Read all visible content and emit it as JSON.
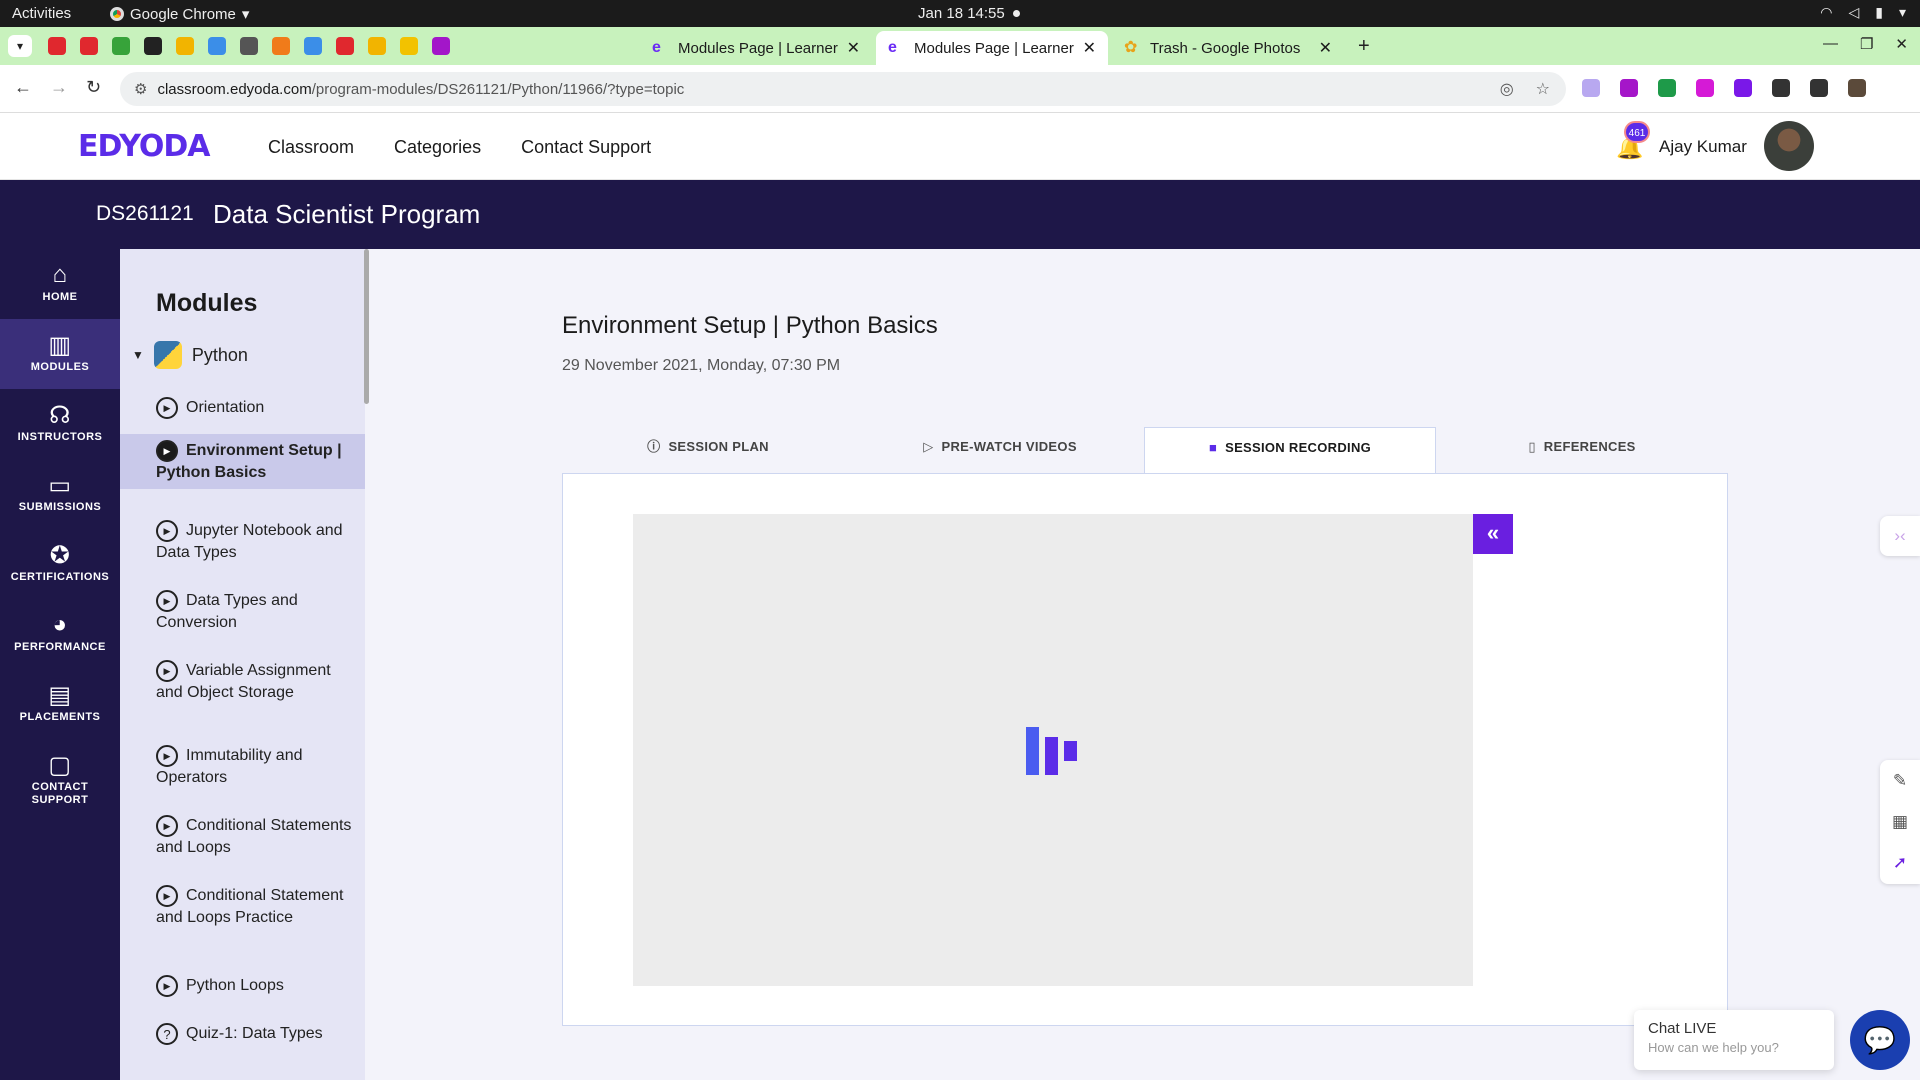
{
  "os": {
    "activities": "Activities",
    "app_name": "Google Chrome",
    "app_caret": "▾",
    "clock": "Jan 18  14:55",
    "tray": [
      "wifi-icon",
      "volume-icon",
      "battery-icon",
      "power-menu-icon"
    ]
  },
  "browser": {
    "tabs": [
      {
        "title": "Modules Page | Learner",
        "active": false
      },
      {
        "title": "Modules Page | Learner",
        "active": true
      },
      {
        "title": "Trash - Google Photos",
        "active": false
      }
    ],
    "tab_close": "✕",
    "new_tab": "+",
    "url_host": "classroom.edyoda.com",
    "url_path": "/program-modules/DS261121/Python/11966/?type=topic",
    "pinned_colors": [
      "#e0282e",
      "#e0282e",
      "#37a33a",
      "#222222",
      "#f2b400",
      "#3b8ee8",
      "#555555",
      "#f07b1a",
      "#3b8ee8",
      "#e0282e",
      "#f2b400",
      "#f2c200",
      "#a316c9"
    ],
    "extension_colors": [
      "#b8a8f0",
      "#a516c9",
      "#1e9a49",
      "#d51ad6",
      "#7a18e8",
      "#333333",
      "#333333",
      "#5b4a3a"
    ]
  },
  "header": {
    "logo": "EDYODA",
    "nav": [
      "Classroom",
      "Categories",
      "Contact Support"
    ],
    "notification_count": "461",
    "user_name": "Ajay Kumar"
  },
  "program": {
    "code": "DS261121",
    "name": "Data Scientist Program"
  },
  "sidebar": {
    "items": [
      {
        "label": "HOME",
        "icon": "home-icon",
        "glyph": "⌂"
      },
      {
        "label": "MODULES",
        "icon": "modules-icon",
        "glyph": "▥"
      },
      {
        "label": "INSTRUCTORS",
        "icon": "instructors-icon",
        "glyph": "☊"
      },
      {
        "label": "SUBMISSIONS",
        "icon": "submissions-icon",
        "glyph": "▭"
      },
      {
        "label": "CERTIFICATIONS",
        "icon": "certifications-icon",
        "glyph": "✪"
      },
      {
        "label": "PERFORMANCE",
        "icon": "performance-icon",
        "glyph": "◕"
      },
      {
        "label": "PLACEMENTS",
        "icon": "placements-icon",
        "glyph": "▤"
      },
      {
        "label": "CONTACT",
        "label2": "SUPPORT",
        "icon": "contact-support-icon",
        "glyph": "▢"
      }
    ],
    "active_index": 1
  },
  "modules": {
    "title": "Modules",
    "group": "Python",
    "items": [
      {
        "label": "Orientation",
        "icon": "play"
      },
      {
        "label": "Environment Setup | Python Basics",
        "icon": "play",
        "active": true
      },
      {
        "label": "Jupyter Notebook and Data Types",
        "icon": "play"
      },
      {
        "label": "Data Types and Conversion",
        "icon": "play"
      },
      {
        "label": "Variable Assignment and Object Storage",
        "icon": "play"
      },
      {
        "label": "Immutability and Operators",
        "icon": "play"
      },
      {
        "label": "Conditional Statements and Loops",
        "icon": "play"
      },
      {
        "label": "Conditional Statement and Loops Practice",
        "icon": "play"
      },
      {
        "label": "Python Loops",
        "icon": "play"
      },
      {
        "label": "Quiz-1: Data Types",
        "icon": "quiz"
      }
    ]
  },
  "session": {
    "title": "Environment Setup | Python Basics",
    "date": "29 November 2021, Monday, 07:30 PM",
    "tabs": [
      {
        "label": "SESSION PLAN",
        "icon": "info-icon",
        "glyph": "ⓘ"
      },
      {
        "label": "PRE-WATCH VIDEOS",
        "icon": "play-circle-icon",
        "glyph": "▷"
      },
      {
        "label": "SESSION RECORDING",
        "icon": "video-camera-icon",
        "glyph": "■"
      },
      {
        "label": "REFERENCES",
        "icon": "document-icon",
        "glyph": "▯"
      }
    ],
    "active_tab": 2,
    "collapse_glyph": "«"
  },
  "chat": {
    "title": "Chat LIVE",
    "subtitle": "How can we help you?"
  },
  "colors": {
    "brand": "#5b2ce8",
    "dark_nav": "#1e1748",
    "tab_strip": "#c8f2bd"
  }
}
